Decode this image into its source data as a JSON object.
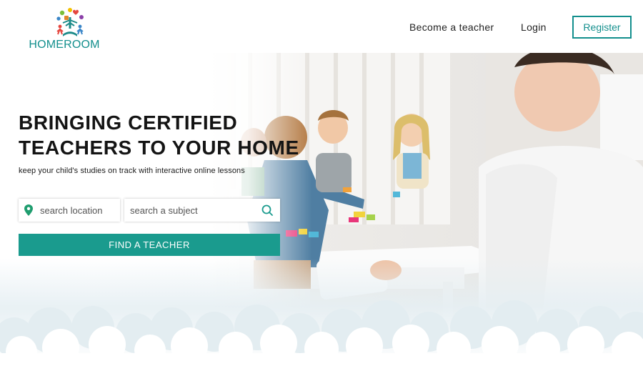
{
  "header": {
    "logo_text": "HOMEROOM",
    "nav": {
      "become_teacher": "Become a teacher",
      "login": "Login",
      "register": "Register"
    }
  },
  "hero": {
    "headline_line1": "BRINGING CERTIFIED",
    "headline_line2": "TEACHERS TO YOUR HOME",
    "subline": "keep your child's studies on track with interactive online lessons",
    "search": {
      "location_placeholder": "search location",
      "subject_placeholder": "search a subject"
    },
    "cta": "FIND A TEACHER"
  },
  "icons": {
    "location": "map-pin-icon",
    "search": "magnifier-icon"
  },
  "colors": {
    "brand": "#138f8d",
    "cta": "#1a9b8e",
    "pin": "#1f9d6f"
  }
}
